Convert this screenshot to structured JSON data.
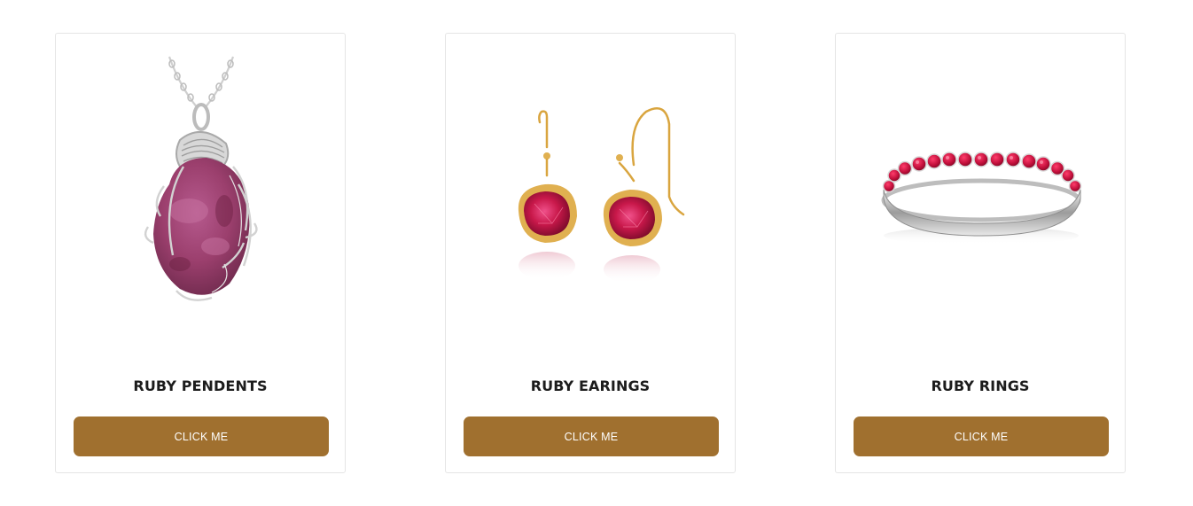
{
  "products": [
    {
      "title": "RUBY PENDENTS",
      "button_label": "CLICK ME",
      "icon": "ruby-pendant-image"
    },
    {
      "title": "RUBY EARINGS",
      "button_label": "CLICK ME",
      "icon": "ruby-earrings-image"
    },
    {
      "title": "RUBY RINGS",
      "button_label": "CLICK ME",
      "icon": "ruby-ring-image"
    }
  ],
  "colors": {
    "button_background": "#a0702f",
    "button_text": "#ffffff",
    "title_text": "#1c1c1c",
    "card_border": "#e5e5e5",
    "ruby": "#c2184a",
    "gold": "#d9a53f",
    "silver": "#c9c9c9"
  }
}
